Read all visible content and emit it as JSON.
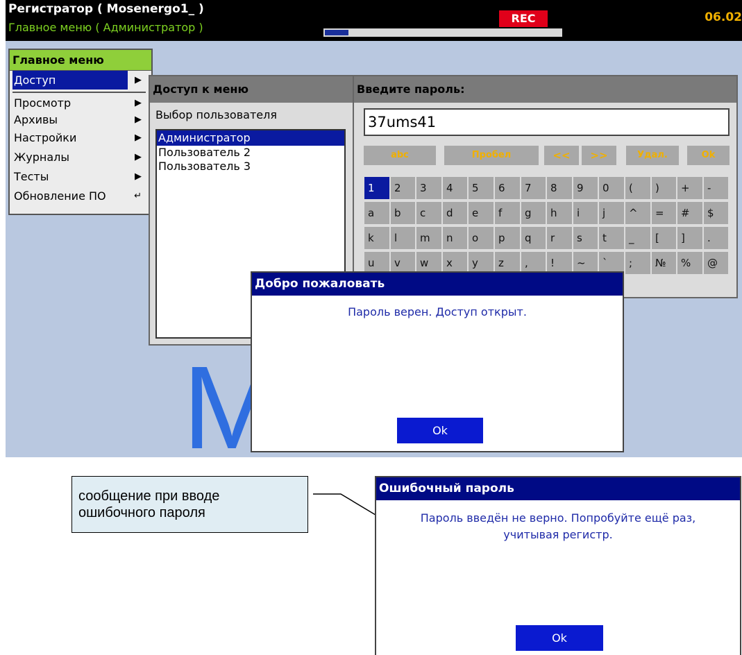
{
  "topbar": {
    "title": "Регистратор ( Mosenergo1_ )",
    "subtitle": "Главное меню ( Администратор )",
    "rec": "REC",
    "clock": "06.02"
  },
  "watermark": {
    "text": "M        en"
  },
  "main_menu": {
    "title": "Главное меню",
    "items": [
      {
        "label": "Доступ",
        "icon": "arrow-right-icon",
        "selected": true
      },
      {
        "label": "Просмотр",
        "icon": "arrow-right-icon"
      },
      {
        "label": "Архивы",
        "icon": "arrow-right-icon"
      },
      {
        "label": "Настройки",
        "icon": "arrow-right-icon"
      },
      {
        "label": "Журналы",
        "icon": "arrow-right-icon"
      },
      {
        "label": "Тесты",
        "icon": "arrow-right-icon"
      },
      {
        "label": "Обновление ПО",
        "icon": "enter-icon"
      }
    ]
  },
  "access_panel": {
    "title": "Доступ к меню",
    "caption": "Выбор пользователя",
    "users": [
      "Администратор",
      "Пользователь  2",
      "Пользователь  3"
    ]
  },
  "password_panel": {
    "title": "Введите пароль:",
    "value": "37ums41",
    "function_keys": [
      "abc",
      "Пробел",
      "<<",
      ">>",
      "Удал.",
      "Ok"
    ],
    "rows": [
      [
        "1",
        "2",
        "3",
        "4",
        "5",
        "6",
        "7",
        "8",
        "9",
        "0",
        "(",
        ")",
        "+",
        "-"
      ],
      [
        "a",
        "b",
        "c",
        "d",
        "e",
        "f",
        "g",
        "h",
        "i",
        "j",
        "^",
        "=",
        "#",
        "$"
      ],
      [
        "k",
        "l",
        "m",
        "n",
        "o",
        "p",
        "q",
        "r",
        "s",
        "t",
        "_",
        "[",
        "]",
        "."
      ],
      [
        "u",
        "v",
        "w",
        "x",
        "y",
        "z",
        ",",
        "!",
        "~",
        "`",
        ";",
        "№",
        "%",
        "@"
      ]
    ]
  },
  "welcome_dialog": {
    "title": "Добро пожаловать",
    "message": "Пароль верен. Доступ открыт.",
    "ok": "Ok"
  },
  "callout": {
    "line1": "сообщение при вводе",
    "line2": "ошибочного пароля"
  },
  "error_dialog": {
    "title": "Ошибочный пароль",
    "line1": "Пароль введён не верно. Попробуйте ещё раз,",
    "line2": "учитывая регистр.",
    "ok": "Ok"
  },
  "colors": {
    "accent": "#0a1aa0",
    "menu_title": "#8fcf3a",
    "rec": "#e0001a",
    "clock": "#f0b000"
  }
}
